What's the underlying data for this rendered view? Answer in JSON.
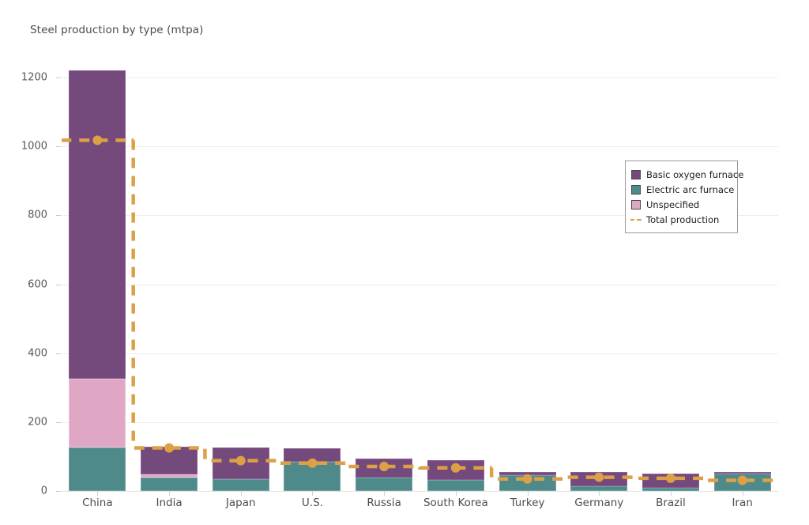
{
  "chart_data": {
    "type": "bar",
    "title": "Steel production by type (mtpa)",
    "xlabel": "",
    "ylabel": "",
    "ylim": [
      0,
      1260
    ],
    "yticks": [
      0,
      200,
      400,
      600,
      800,
      1000,
      1200
    ],
    "grid": true,
    "stacked": true,
    "legend_position": "upper right",
    "categories": [
      "China",
      "India",
      "Japan",
      "U.S.",
      "Russia",
      "South Korea",
      "Turkey",
      "Germany",
      "Brazil",
      "Iran"
    ],
    "series": [
      {
        "name": "Electric arc furnace",
        "color": "#4E8A89",
        "values": [
          127,
          40,
          34,
          84,
          38,
          33,
          45,
          14,
          10,
          51
        ]
      },
      {
        "name": "Unspecified",
        "color": "#DFA7C4",
        "values": [
          198,
          8,
          0,
          0,
          0,
          0,
          0,
          0,
          0,
          0
        ]
      },
      {
        "name": "Basic oxygen furnace",
        "color": "#74497B",
        "values": [
          895,
          80,
          92,
          41,
          57,
          57,
          11,
          42,
          40,
          5
        ]
      }
    ],
    "overlay": {
      "name": "Total production",
      "type": "step-line",
      "style": "dashed",
      "color": "#DCA147",
      "marker": "circle",
      "values": [
        1018,
        125,
        88,
        81,
        71,
        67,
        35,
        40,
        37,
        31
      ]
    },
    "totals": [
      1220,
      128,
      126,
      125,
      95,
      90,
      56,
      56,
      50,
      56
    ]
  },
  "legend": {
    "items": [
      {
        "label": "Basic oxygen furnace",
        "swatch": "bof-swatch"
      },
      {
        "label": "Electric arc furnace",
        "swatch": "eaf-swatch"
      },
      {
        "label": "Unspecified",
        "swatch": "unspecified-swatch"
      },
      {
        "label": "Total production",
        "swatch": "total-production-line"
      }
    ]
  },
  "colors": {
    "basic_oxygen_furnace": "#74497B",
    "electric_arc_furnace": "#4E8A89",
    "unspecified": "#DFA7C4",
    "total_production": "#DCA147",
    "grid": "#EEEEEE",
    "background": "#FFFFFF",
    "text": "#4A4A4A"
  }
}
